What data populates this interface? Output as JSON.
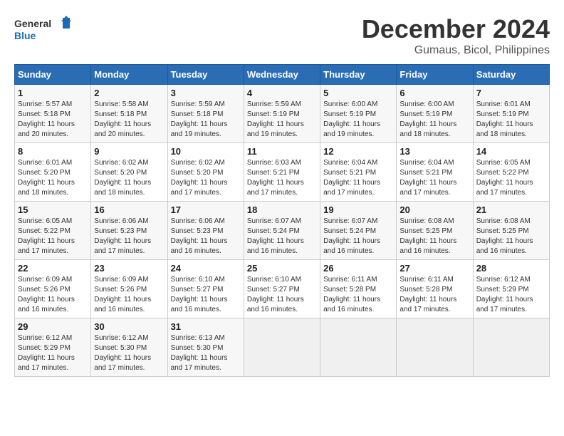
{
  "logo": {
    "line1": "General",
    "line2": "Blue"
  },
  "title": "December 2024",
  "subtitle": "Gumaus, Bicol, Philippines",
  "days_header": [
    "Sunday",
    "Monday",
    "Tuesday",
    "Wednesday",
    "Thursday",
    "Friday",
    "Saturday"
  ],
  "weeks": [
    [
      {
        "day": "1",
        "info": "Sunrise: 5:57 AM\nSunset: 5:18 PM\nDaylight: 11 hours\nand 20 minutes."
      },
      {
        "day": "2",
        "info": "Sunrise: 5:58 AM\nSunset: 5:18 PM\nDaylight: 11 hours\nand 20 minutes."
      },
      {
        "day": "3",
        "info": "Sunrise: 5:59 AM\nSunset: 5:18 PM\nDaylight: 11 hours\nand 19 minutes."
      },
      {
        "day": "4",
        "info": "Sunrise: 5:59 AM\nSunset: 5:19 PM\nDaylight: 11 hours\nand 19 minutes."
      },
      {
        "day": "5",
        "info": "Sunrise: 6:00 AM\nSunset: 5:19 PM\nDaylight: 11 hours\nand 19 minutes."
      },
      {
        "day": "6",
        "info": "Sunrise: 6:00 AM\nSunset: 5:19 PM\nDaylight: 11 hours\nand 18 minutes."
      },
      {
        "day": "7",
        "info": "Sunrise: 6:01 AM\nSunset: 5:19 PM\nDaylight: 11 hours\nand 18 minutes."
      }
    ],
    [
      {
        "day": "8",
        "info": "Sunrise: 6:01 AM\nSunset: 5:20 PM\nDaylight: 11 hours\nand 18 minutes."
      },
      {
        "day": "9",
        "info": "Sunrise: 6:02 AM\nSunset: 5:20 PM\nDaylight: 11 hours\nand 18 minutes."
      },
      {
        "day": "10",
        "info": "Sunrise: 6:02 AM\nSunset: 5:20 PM\nDaylight: 11 hours\nand 17 minutes."
      },
      {
        "day": "11",
        "info": "Sunrise: 6:03 AM\nSunset: 5:21 PM\nDaylight: 11 hours\nand 17 minutes."
      },
      {
        "day": "12",
        "info": "Sunrise: 6:04 AM\nSunset: 5:21 PM\nDaylight: 11 hours\nand 17 minutes."
      },
      {
        "day": "13",
        "info": "Sunrise: 6:04 AM\nSunset: 5:21 PM\nDaylight: 11 hours\nand 17 minutes."
      },
      {
        "day": "14",
        "info": "Sunrise: 6:05 AM\nSunset: 5:22 PM\nDaylight: 11 hours\nand 17 minutes."
      }
    ],
    [
      {
        "day": "15",
        "info": "Sunrise: 6:05 AM\nSunset: 5:22 PM\nDaylight: 11 hours\nand 17 minutes."
      },
      {
        "day": "16",
        "info": "Sunrise: 6:06 AM\nSunset: 5:23 PM\nDaylight: 11 hours\nand 17 minutes."
      },
      {
        "day": "17",
        "info": "Sunrise: 6:06 AM\nSunset: 5:23 PM\nDaylight: 11 hours\nand 16 minutes."
      },
      {
        "day": "18",
        "info": "Sunrise: 6:07 AM\nSunset: 5:24 PM\nDaylight: 11 hours\nand 16 minutes."
      },
      {
        "day": "19",
        "info": "Sunrise: 6:07 AM\nSunset: 5:24 PM\nDaylight: 11 hours\nand 16 minutes."
      },
      {
        "day": "20",
        "info": "Sunrise: 6:08 AM\nSunset: 5:25 PM\nDaylight: 11 hours\nand 16 minutes."
      },
      {
        "day": "21",
        "info": "Sunrise: 6:08 AM\nSunset: 5:25 PM\nDaylight: 11 hours\nand 16 minutes."
      }
    ],
    [
      {
        "day": "22",
        "info": "Sunrise: 6:09 AM\nSunset: 5:26 PM\nDaylight: 11 hours\nand 16 minutes."
      },
      {
        "day": "23",
        "info": "Sunrise: 6:09 AM\nSunset: 5:26 PM\nDaylight: 11 hours\nand 16 minutes."
      },
      {
        "day": "24",
        "info": "Sunrise: 6:10 AM\nSunset: 5:27 PM\nDaylight: 11 hours\nand 16 minutes."
      },
      {
        "day": "25",
        "info": "Sunrise: 6:10 AM\nSunset: 5:27 PM\nDaylight: 11 hours\nand 16 minutes."
      },
      {
        "day": "26",
        "info": "Sunrise: 6:11 AM\nSunset: 5:28 PM\nDaylight: 11 hours\nand 16 minutes."
      },
      {
        "day": "27",
        "info": "Sunrise: 6:11 AM\nSunset: 5:28 PM\nDaylight: 11 hours\nand 17 minutes."
      },
      {
        "day": "28",
        "info": "Sunrise: 6:12 AM\nSunset: 5:29 PM\nDaylight: 11 hours\nand 17 minutes."
      }
    ],
    [
      {
        "day": "29",
        "info": "Sunrise: 6:12 AM\nSunset: 5:29 PM\nDaylight: 11 hours\nand 17 minutes."
      },
      {
        "day": "30",
        "info": "Sunrise: 6:12 AM\nSunset: 5:30 PM\nDaylight: 11 hours\nand 17 minutes."
      },
      {
        "day": "31",
        "info": "Sunrise: 6:13 AM\nSunset: 5:30 PM\nDaylight: 11 hours\nand 17 minutes."
      },
      {
        "day": "",
        "info": ""
      },
      {
        "day": "",
        "info": ""
      },
      {
        "day": "",
        "info": ""
      },
      {
        "day": "",
        "info": ""
      }
    ]
  ]
}
